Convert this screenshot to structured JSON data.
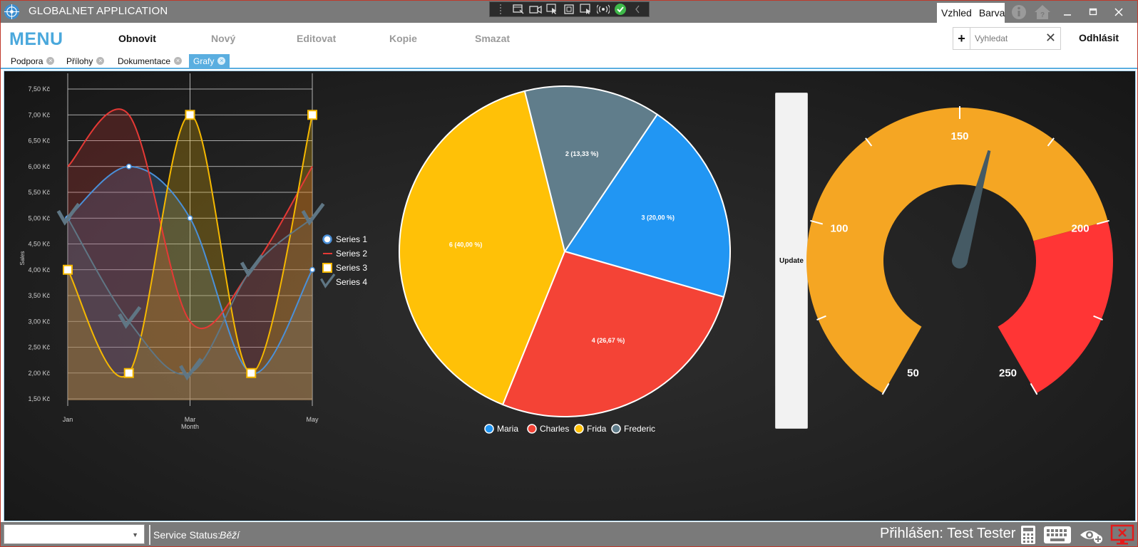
{
  "app": {
    "title": "GLOBALNET APPLICATION"
  },
  "titlebar": {
    "tabs": [
      "Vzhled",
      "Barva"
    ],
    "tool_icons": [
      "grip-icon",
      "select-window-icon",
      "video-icon",
      "pointer-icon",
      "capture-region-icon",
      "capture-window-icon",
      "broadcast-icon",
      "check-icon",
      "chevron-left-icon"
    ]
  },
  "menu": {
    "title": "MENU",
    "items": [
      {
        "label": "Obnovit",
        "enabled": true
      },
      {
        "label": "Nový",
        "enabled": false
      },
      {
        "label": "Editovat",
        "enabled": false
      },
      {
        "label": "Kopie",
        "enabled": false
      },
      {
        "label": "Smazat",
        "enabled": false
      }
    ],
    "search_placeholder": "Vyhledat",
    "logout": "Odhlásit"
  },
  "tabs": [
    {
      "label": "Podpora",
      "active": false
    },
    {
      "label": "Přílohy",
      "active": false
    },
    {
      "label": "Dokumentace",
      "active": false
    },
    {
      "label": "Grafy",
      "active": true
    }
  ],
  "chart_data": [
    {
      "type": "line",
      "ylabel": "Sales",
      "xlabel": "Month",
      "x_ticks": [
        "Jan",
        "Mar",
        "May"
      ],
      "y_tick_labels": [
        "1,50 Kč",
        "2,00 Kč",
        "2,50 Kč",
        "3,00 Kč",
        "3,50 Kč",
        "4,00 Kč",
        "4,50 Kč",
        "5,00 Kč",
        "5,50 Kč",
        "6,00 Kč",
        "6,50 Kč",
        "7,00 Kč",
        "7,50 Kč"
      ],
      "ylim": [
        1.5,
        7.5
      ],
      "grid": true,
      "legend_position": "right",
      "series": [
        {
          "name": "Series 1",
          "color": "#4a90d9",
          "marker": "circle",
          "values": [
            5.0,
            6.0,
            5.0,
            2.0,
            4.0
          ]
        },
        {
          "name": "Series 2",
          "color": "#e53935",
          "marker": "none",
          "values": [
            6.0,
            7.0,
            3.0,
            4.0,
            6.0
          ]
        },
        {
          "name": "Series 3",
          "color": "#f5b800",
          "marker": "square",
          "values": [
            4.0,
            2.0,
            7.0,
            2.0,
            7.0
          ]
        },
        {
          "name": "Series 4",
          "color": "#5f7684",
          "marker": "check",
          "values": [
            5.0,
            3.0,
            2.0,
            4.0,
            5.0
          ]
        }
      ]
    },
    {
      "type": "pie",
      "slices": [
        {
          "name": "Maria",
          "value": 3,
          "label": "3 (20,00 %)",
          "color": "#2196f3"
        },
        {
          "name": "Charles",
          "value": 4,
          "label": "4 (26,67 %)",
          "color": "#f44336"
        },
        {
          "name": "Frida",
          "value": 6,
          "label": "6 (40,00 %)",
          "color": "#ffc107"
        },
        {
          "name": "Frederic",
          "value": 2,
          "label": "2 (13,33 %)",
          "color": "#607d8b"
        }
      ],
      "legend_position": "bottom"
    },
    {
      "type": "gauge",
      "min": 50,
      "max": 250,
      "tick_labels": [
        "50",
        "100",
        "150",
        "200",
        "250"
      ],
      "value": 160,
      "ranges": [
        {
          "from": 50,
          "to": 200,
          "color": "#f5a623"
        },
        {
          "from": 200,
          "to": 250,
          "color": "#ff3535"
        }
      ],
      "needle_color": "#455a64"
    }
  ],
  "update_button": "Update",
  "status": {
    "label": "Service Status:",
    "value": "Běží",
    "user": "Přihlášen: Test Tester"
  }
}
